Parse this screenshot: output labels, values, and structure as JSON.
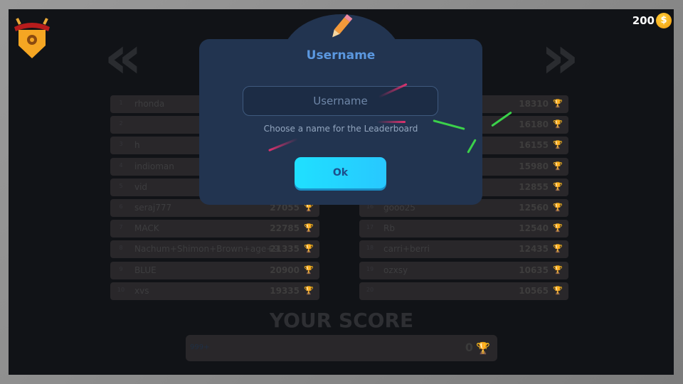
{
  "header": {
    "coins": "200",
    "coin_icon": "dollar-coin-icon",
    "coin_symbol": "$"
  },
  "leaderboard": {
    "left": [
      {
        "rank": "1",
        "name": "rhonda",
        "score": ""
      },
      {
        "rank": "2",
        "name": "",
        "score": ""
      },
      {
        "rank": "3",
        "name": "h",
        "score": ""
      },
      {
        "rank": "4",
        "name": "indioman",
        "score": ""
      },
      {
        "rank": "5",
        "name": "vid",
        "score": ""
      },
      {
        "rank": "6",
        "name": "seraj777",
        "score": "27055"
      },
      {
        "rank": "7",
        "name": "MACK",
        "score": "22785"
      },
      {
        "rank": "8",
        "name": "Nachum+Shimon+Brown+age+9",
        "score": "21335"
      },
      {
        "rank": "9",
        "name": "BLUE",
        "score": "20900"
      },
      {
        "rank": "10",
        "name": "xvs",
        "score": "19335"
      }
    ],
    "right": [
      {
        "rank": "11",
        "name": "",
        "score": "18310"
      },
      {
        "rank": "12",
        "name": "",
        "score": "16180"
      },
      {
        "rank": "13",
        "name": "",
        "score": "16155"
      },
      {
        "rank": "14",
        "name": "",
        "score": "15980"
      },
      {
        "rank": "15",
        "name": "",
        "score": "12855"
      },
      {
        "rank": "16",
        "name": "gooo25",
        "score": "12560"
      },
      {
        "rank": "17",
        "name": "Rb",
        "score": "12540"
      },
      {
        "rank": "18",
        "name": "carri+berri",
        "score": "12435"
      },
      {
        "rank": "19",
        "name": "ozxsy",
        "score": "10635"
      },
      {
        "rank": "20",
        "name": "",
        "score": "10565"
      }
    ]
  },
  "your_score": {
    "title": "YOUR SCORE",
    "rank": "999+",
    "score": "0"
  },
  "modal": {
    "title": "Username",
    "input_value": "",
    "input_placeholder": "Username",
    "hint": "Choose a name for the Leaderboard",
    "ok_label": "Ok"
  },
  "colors": {
    "modal_bg": "#223450",
    "title": "#5b98e0",
    "ok_button": "#1fe0ff"
  }
}
